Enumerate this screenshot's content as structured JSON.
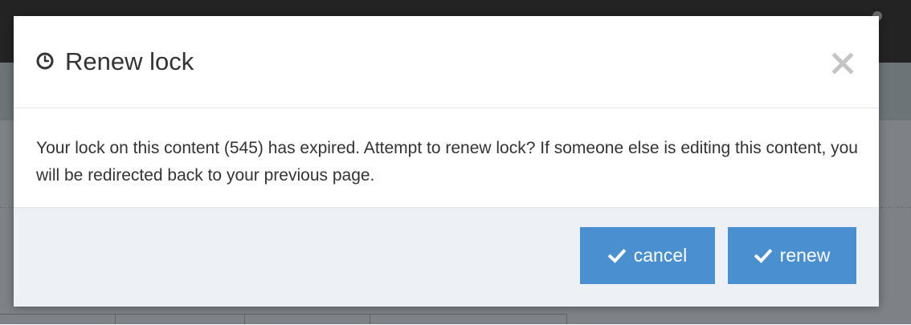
{
  "dialog": {
    "title": "Renew lock",
    "title_icon": "clock-icon",
    "close_icon": "close-icon",
    "message": "Your lock on this content (545) has expired. Attempt to renew lock? If someone else is editing this content, you will be redirected back to your previous page.",
    "buttons": {
      "cancel_label": "cancel",
      "renew_label": "renew",
      "icon": "checkmark-icon"
    }
  },
  "colors": {
    "button_primary": "#4a8fcf",
    "footer_bg": "#edf1f5",
    "text": "#333333",
    "close_icon": "#c4c4c4"
  }
}
